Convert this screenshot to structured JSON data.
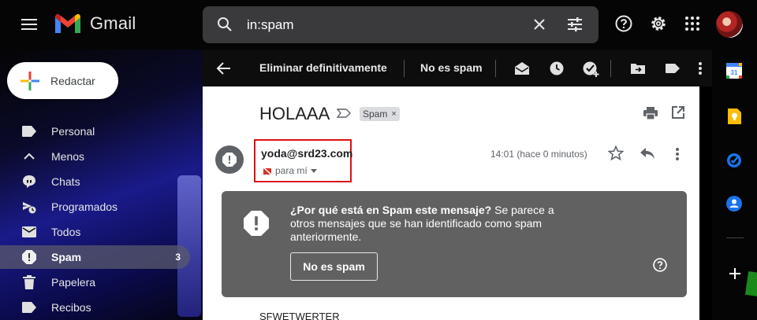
{
  "app": {
    "name": "Gmail"
  },
  "search": {
    "value": "in:spam"
  },
  "compose": {
    "label": "Redactar"
  },
  "nav": {
    "items": [
      {
        "label": "Personal",
        "icon": "label-icon"
      },
      {
        "label": "Menos",
        "icon": "chevron-up-icon"
      },
      {
        "label": "Chats",
        "icon": "chat-icon"
      },
      {
        "label": "Programados",
        "icon": "schedule-send-icon"
      },
      {
        "label": "Todos",
        "icon": "mail-icon"
      },
      {
        "label": "Spam",
        "icon": "report-icon",
        "count": "3",
        "active": true
      },
      {
        "label": "Papelera",
        "icon": "trash-icon"
      },
      {
        "label": "Recibos",
        "icon": "label-icon"
      }
    ]
  },
  "toolbar": {
    "delete_forever": "Eliminar definitivamente",
    "not_spam": "No es spam"
  },
  "message": {
    "subject": "HOLAAA",
    "label_chip": "Spam",
    "label_chip_close": "×",
    "sender_email": "yoda@srd23.com",
    "recipient": "para mí",
    "time": "14:01 (hace 0 minutos)",
    "body": "SFWETWERTER"
  },
  "warning": {
    "title": "¿Por qué está en Spam este mensaje?",
    "text": "Se parece a otros mensajes que se han identificado como spam anteriormente.",
    "button": "No es spam"
  },
  "colors": {
    "highlight_border": "#e01010",
    "warning_bg": "#616161",
    "active_nav_bg": "#5a5a6e"
  }
}
